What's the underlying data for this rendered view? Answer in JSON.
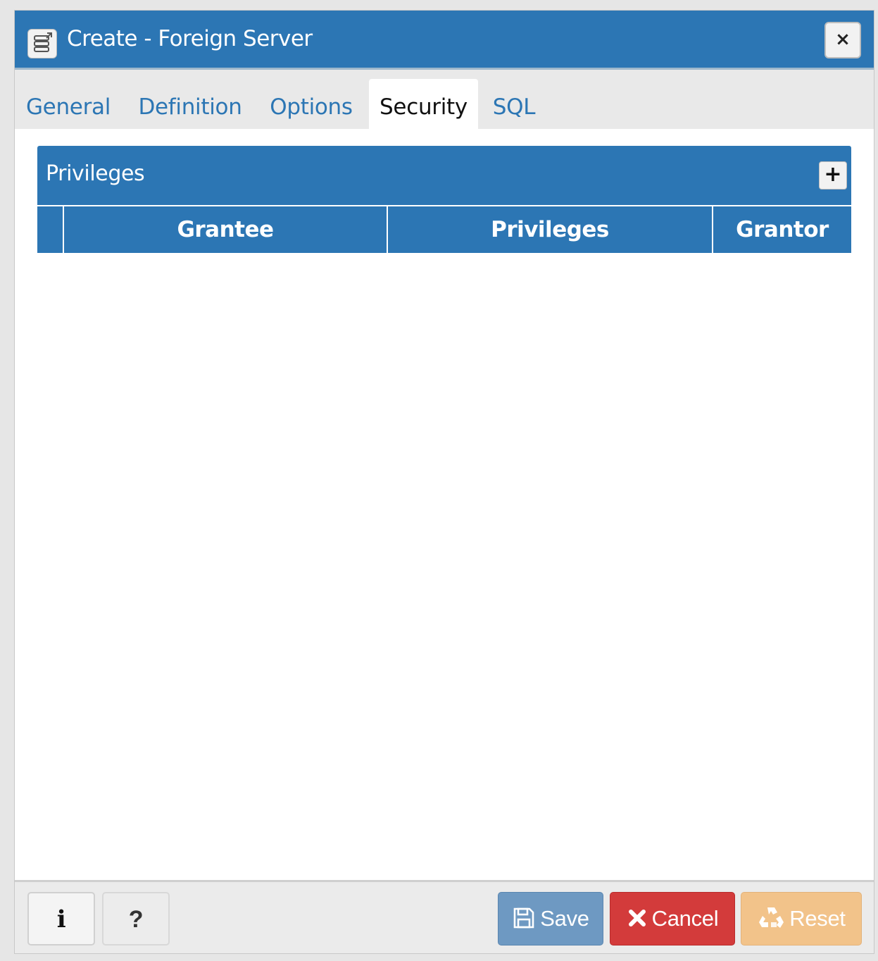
{
  "dialog": {
    "title": "Create - Foreign Server",
    "title_icon": "foreign-server-icon",
    "close_icon": "close-icon",
    "close_label": "×"
  },
  "tabs": [
    {
      "label": "General",
      "active": false
    },
    {
      "label": "Definition",
      "active": false
    },
    {
      "label": "Options",
      "active": false
    },
    {
      "label": "Security",
      "active": true
    },
    {
      "label": "SQL",
      "active": false
    }
  ],
  "privileges": {
    "title": "Privileges",
    "add_icon": "plus-icon",
    "add_label": "+",
    "columns": [
      "Grantee",
      "Privileges",
      "Grantor"
    ],
    "rows": []
  },
  "footer": {
    "info_label": "i",
    "help_label": "?",
    "save_label": "Save",
    "cancel_label": "Cancel",
    "reset_label": "Reset"
  },
  "colors": {
    "primary": "#2c76b4",
    "save": "#6e99c2",
    "cancel": "#d33b3b",
    "reset": "#f2c38a"
  }
}
